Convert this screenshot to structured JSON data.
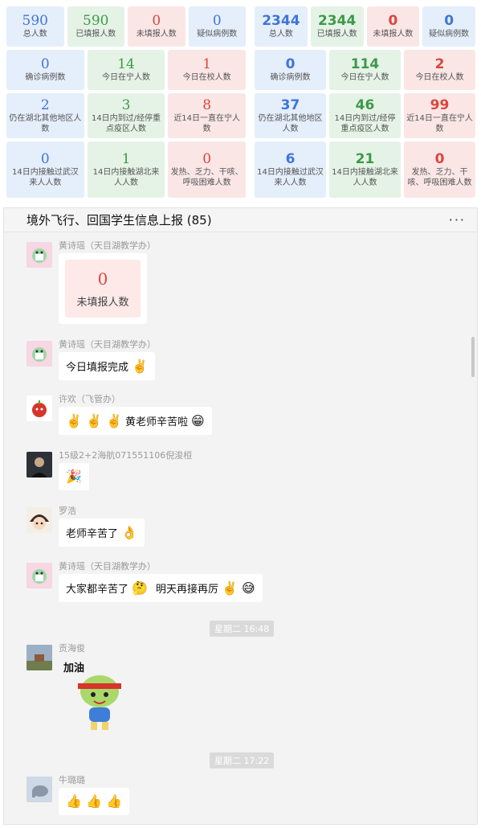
{
  "stats_left": {
    "rows": [
      [
        {
          "num": "590",
          "label": "总人数",
          "color": "blue"
        },
        {
          "num": "590",
          "label": "已填报人数",
          "color": "green"
        },
        {
          "num": "0",
          "label": "未填报人数",
          "color": "red"
        },
        {
          "num": "0",
          "label": "疑似病例数",
          "color": "blue"
        }
      ],
      [
        {
          "num": "0",
          "label": "确诊病例数",
          "color": "blue"
        },
        {
          "num": "14",
          "label": "今日在宁人数",
          "color": "green"
        },
        {
          "num": "1",
          "label": "今日在校人数",
          "color": "red"
        }
      ],
      [
        {
          "num": "2",
          "label": "仍在湖北其他地区人数",
          "color": "blue"
        },
        {
          "num": "3",
          "label": "14日内到过/经停重点疫区人数",
          "color": "green"
        },
        {
          "num": "8",
          "label": "近14日一直在宁人数",
          "color": "red"
        }
      ],
      [
        {
          "num": "0",
          "label": "14日内接触过武汉来人人数",
          "color": "blue"
        },
        {
          "num": "1",
          "label": "14日内接触湖北来人人数",
          "color": "green"
        },
        {
          "num": "0",
          "label": "发热、乏力、干咳、呼吸困难人数",
          "color": "red"
        }
      ]
    ]
  },
  "stats_right": {
    "rows": [
      [
        {
          "num": "2344",
          "label": "总人数",
          "color": "blue"
        },
        {
          "num": "2344",
          "label": "已填报人数",
          "color": "green"
        },
        {
          "num": "0",
          "label": "未填报人数",
          "color": "red"
        },
        {
          "num": "0",
          "label": "疑似病例数",
          "color": "blue"
        }
      ],
      [
        {
          "num": "0",
          "label": "确诊病例数",
          "color": "blue"
        },
        {
          "num": "114",
          "label": "今日在宁人数",
          "color": "green"
        },
        {
          "num": "2",
          "label": "今日在校人数",
          "color": "red"
        }
      ],
      [
        {
          "num": "37",
          "label": "仍在湖北其他地区人数",
          "color": "blue"
        },
        {
          "num": "46",
          "label": "14日内到过/经停重点疫区人数",
          "color": "green"
        },
        {
          "num": "99",
          "label": "近14日一直在宁人数",
          "color": "red"
        }
      ],
      [
        {
          "num": "6",
          "label": "14日内接触过武汉来人人数",
          "color": "blue"
        },
        {
          "num": "21",
          "label": "14日内接触湖北来人人数",
          "color": "green"
        },
        {
          "num": "0",
          "label": "发热、乏力、干咳、呼吸困难人数",
          "color": "red"
        }
      ]
    ]
  },
  "chat": {
    "title": "境外飞行、回国学生信息上报 (85)",
    "more_icon": "···",
    "messages": {
      "m1": {
        "sender": "黄诗瑶（天目湖教学办）",
        "card_num": "0",
        "card_label": "未填报人数"
      },
      "m2": {
        "sender": "黄诗瑶（天目湖教学办）",
        "text": "今日填报完成",
        "emoji": "✌️"
      },
      "m3": {
        "sender": "许欢（飞管办）",
        "emoji_prefix": "✌️ ✌️ ✌️",
        "text": "黄老师辛苦啦",
        "emoji": "😁"
      },
      "m4": {
        "sender": "15级2+2海航071551106倪浚桓",
        "emoji": "🎉"
      },
      "m5": {
        "sender": "罗浩",
        "text": "老师辛苦了",
        "emoji": "👌"
      },
      "m6": {
        "sender": "黄诗瑶（天目湖教学办）",
        "text": "大家都辛苦了",
        "emoji_mid": "🤔",
        "text2": "明天再接再厉",
        "emoji": "✌️ 😅"
      },
      "time1": "星期二 16:48",
      "m7": {
        "sender": "贡海俊",
        "sticker_text": "加油"
      },
      "time2": "星期二 17:22",
      "m8": {
        "sender": "牛璐璐",
        "emoji": "👍 👍 👍"
      }
    }
  }
}
